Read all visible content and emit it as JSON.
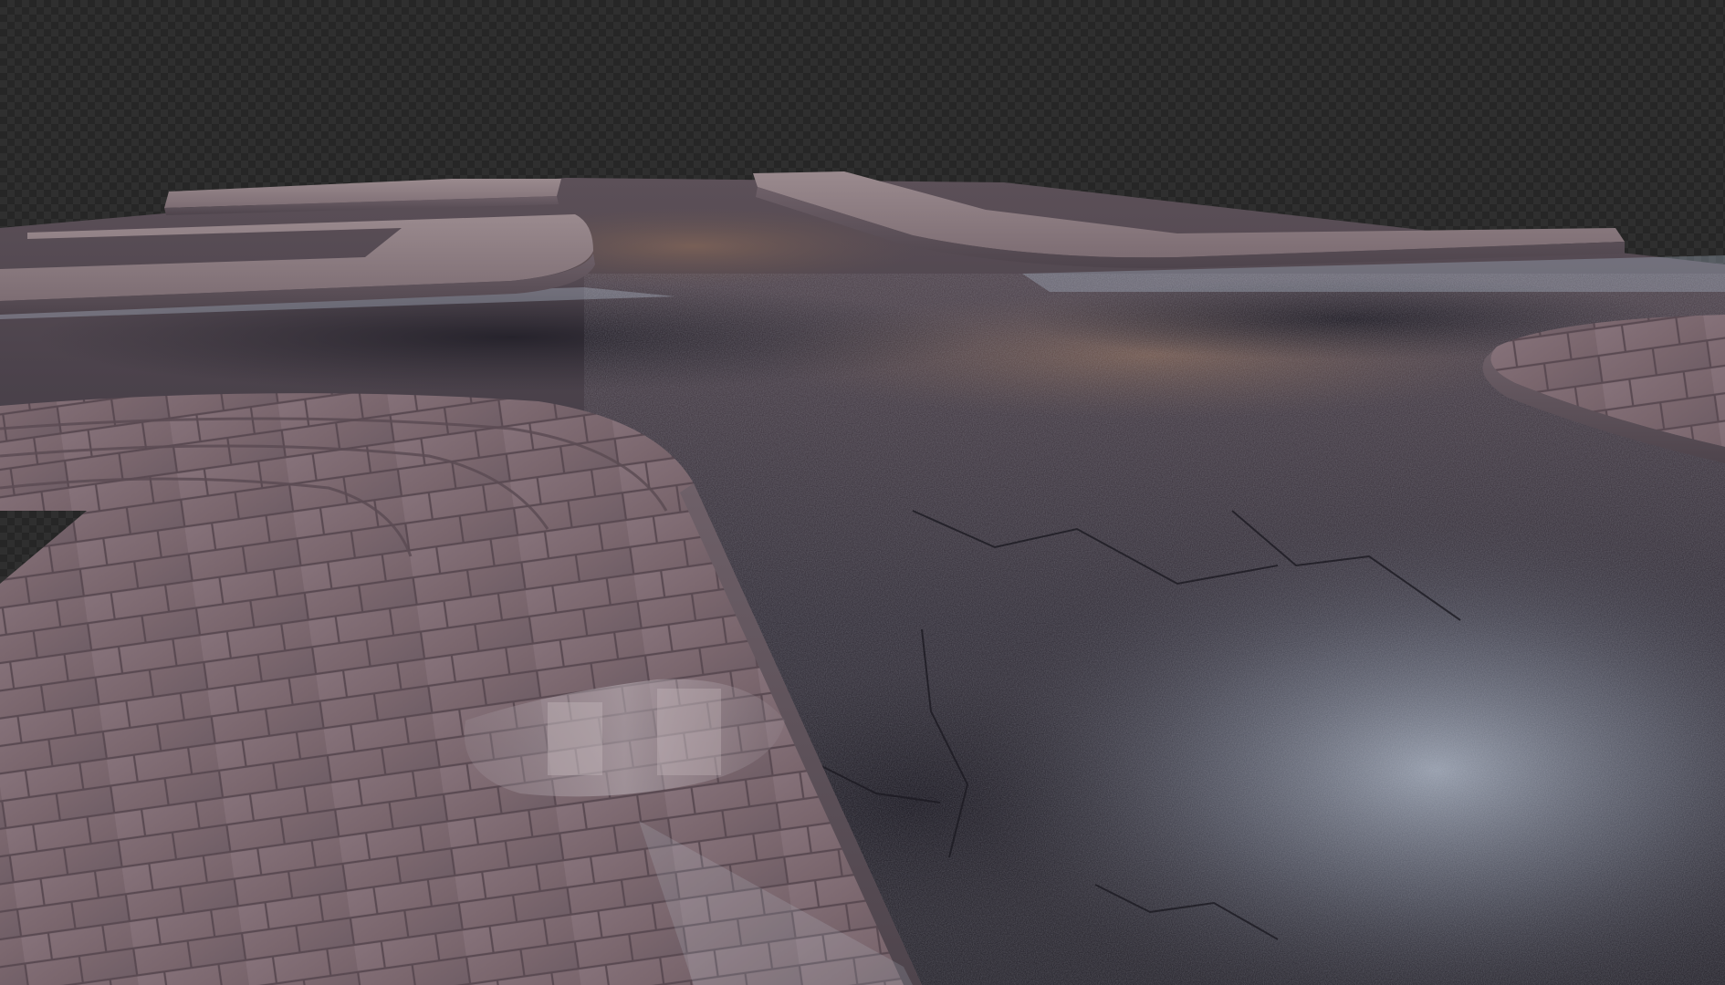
{
  "scene": {
    "subject": "3d-render-street-intersection",
    "background": {
      "pattern": "transparency-checkerboard",
      "color_light": "#2f2f2f",
      "color_dark": "#262626"
    },
    "colors": {
      "asphalt_dark": "#2a2a32",
      "asphalt_mid": "#4a4550",
      "asphalt_warm": "#6e5a52",
      "asphalt_wet_sheen": "#aab6c8",
      "curb_top": "#8c7a80",
      "curb_side": "#6b5e66",
      "pavement_tile": "#7f6a70",
      "pavement_grout": "#5b4c54",
      "puddle": "#9aa6b8"
    }
  }
}
